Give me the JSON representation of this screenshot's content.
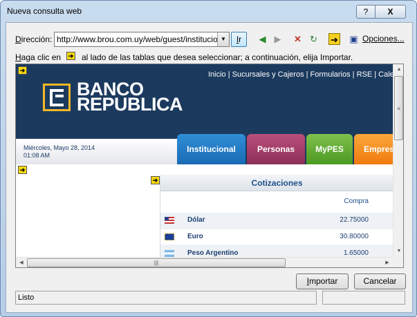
{
  "window": {
    "title": "Nueva consulta web",
    "help": "?",
    "close": "X"
  },
  "address": {
    "label_u": "D",
    "label_rest": "irección:",
    "value": "http://www.brou.com.uy/web/guest/institucional"
  },
  "toolbar": {
    "go_u": "I",
    "go_rest": "r",
    "options_u": "O",
    "options_rest": "pciones..."
  },
  "instruction": {
    "part_a_u": "H",
    "part_a_rest": "aga clic en",
    "part_b": "al lado de las tablas que desea seleccionar; a continuación, elija Importar."
  },
  "site": {
    "toplinks": "Inicio | Sucursales y Cajeros | Formularios | RSE | Calendario",
    "logo_line1": "BANCO",
    "logo_line2": "REPUBLICA",
    "date": "Miércoles, Mayo 28, 2014",
    "time": "01:08 AM",
    "tabs": [
      "Institucional",
      "Personas",
      "MyPES",
      "Empresas"
    ],
    "cotizaciones": {
      "title": "Cotizaciones",
      "column": "Compra",
      "rows": [
        {
          "name": "Dólar",
          "value": "22.75000",
          "flag": "us-flag-icon"
        },
        {
          "name": "Euro",
          "value": "30.80000",
          "flag": "eu-flag-icon"
        },
        {
          "name": "Peso Argentino",
          "value": "1.65000",
          "flag": "ar-flag-icon"
        }
      ]
    }
  },
  "buttons": {
    "import_u": "I",
    "import_rest": "mportar",
    "cancel": "Cancelar"
  },
  "status": {
    "text": "Listo"
  },
  "colors": {
    "header_bg": "#1c3a5e",
    "accent_yellow": "#f2b928",
    "tab_institucional": "#1a6ab4",
    "tab_personas": "#8e2f58",
    "tab_mypes": "#4b9a22",
    "tab_empresas": "#f07a0e"
  }
}
